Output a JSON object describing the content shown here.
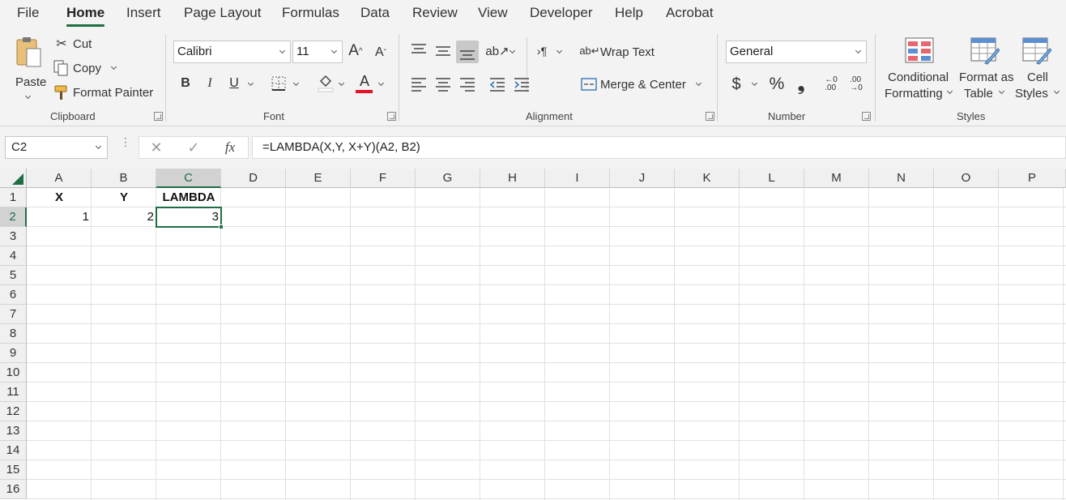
{
  "menu": {
    "tabs": [
      "File",
      "Home",
      "Insert",
      "Page Layout",
      "Formulas",
      "Data",
      "Review",
      "View",
      "Developer",
      "Help",
      "Acrobat"
    ],
    "active": "Home"
  },
  "clipboard": {
    "paste": "Paste",
    "cut": "Cut",
    "copy": "Copy",
    "format_painter": "Format Painter",
    "label": "Clipboard"
  },
  "font": {
    "name": "Calibri",
    "size": "11",
    "bold": "B",
    "italic": "I",
    "underline": "U",
    "label": "Font",
    "font_color": "#e81123"
  },
  "alignment": {
    "wrap_text": "Wrap Text",
    "merge_center": "Merge & Center",
    "label": "Alignment"
  },
  "number": {
    "format": "General",
    "label": "Number"
  },
  "styles": {
    "conditional_1": "Conditional",
    "conditional_2": "Formatting",
    "format_table_1": "Format as",
    "format_table_2": "Table",
    "cell_styles_1": "Cell",
    "cell_styles_2": "Styles",
    "label": "Styles"
  },
  "formula_bar": {
    "name_box": "C2",
    "fx": "fx",
    "formula": "=LAMBDA(X,Y, X+Y)(A2, B2)"
  },
  "sheet": {
    "columns": [
      "A",
      "B",
      "C",
      "D",
      "E",
      "F",
      "G",
      "H",
      "I",
      "J",
      "K",
      "L",
      "M",
      "N",
      "O",
      "P"
    ],
    "rows": [
      "1",
      "2",
      "3",
      "4",
      "5",
      "6",
      "7",
      "8",
      "9",
      "10",
      "11",
      "12",
      "13",
      "14",
      "15",
      "16"
    ],
    "selected_column": "C",
    "selected_row": "2",
    "cells": {
      "A1": "X",
      "B1": "Y",
      "C1": "LAMBDA",
      "A2": "1",
      "B2": "2",
      "C2": "3"
    },
    "accent_color": "#1e6e42"
  }
}
